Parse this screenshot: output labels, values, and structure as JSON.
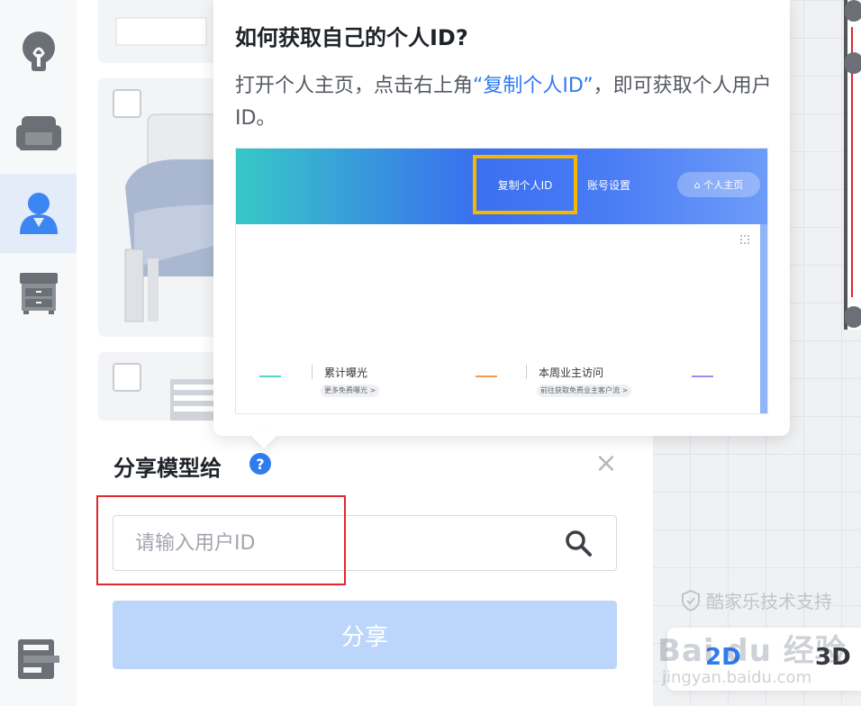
{
  "rail": {
    "items": [
      {
        "name": "bulb-icon"
      },
      {
        "name": "sofa-icon"
      },
      {
        "name": "user-icon",
        "active": true
      },
      {
        "name": "cabinet-icon"
      },
      {
        "name": "layout-icon"
      }
    ]
  },
  "popover": {
    "title": "如何获取自己的个人ID?",
    "text_before": "打开个人主页，点击右上角",
    "text_link": "“复制个人ID”",
    "text_after": "，即可获取个人用户ID。",
    "preview": {
      "copy_label": "复制个人ID",
      "settings_label": "账号设置",
      "home_label": "⌂ 个人主页",
      "stat1_label": "累计曝光",
      "stat1_chip": "更多免费曝光 >",
      "stat2_label": "本周业主访问",
      "stat2_chip": "前往获取免费业主客户流 >"
    }
  },
  "share": {
    "title": "分享模型给",
    "help": "?",
    "close": "×",
    "placeholder": "请输入用户ID",
    "button_label": "分享"
  },
  "support": {
    "label": "酷家乐技术支持"
  },
  "view_toggle": {
    "label_2d": "2D",
    "label_3d": "3D"
  },
  "watermark": {
    "main": "Bai du 经验",
    "sub": "jingyan.baidu.com"
  },
  "colors": {
    "accent": "#2f7bf0",
    "highlight": "#e0282e",
    "disabled_button": "#bcd6fb",
    "preview_frame": "#f5b800"
  }
}
